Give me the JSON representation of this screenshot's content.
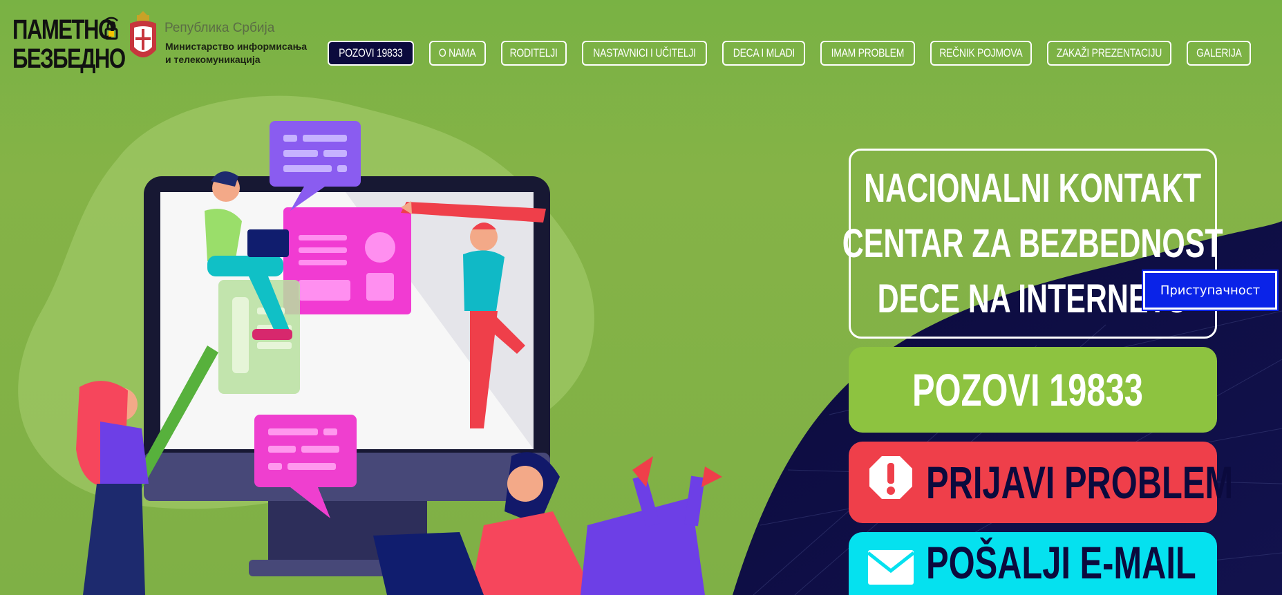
{
  "brand": {
    "logo_line1": "ПАМЕТНО",
    "logo_line2": "БЕЗБЕДНО",
    "gov_republic": "Република Србија",
    "gov_ministry_line1": "Министарство информисања",
    "gov_ministry_line2": "и телекомуникација"
  },
  "nav": {
    "items": [
      {
        "label": "POZOVI 19833",
        "active": true
      },
      {
        "label": "O NAMA"
      },
      {
        "label": "RODITELJI"
      },
      {
        "label": "NASTAVNICI I UČITELJI"
      },
      {
        "label": "DECA I MLADI"
      },
      {
        "label": "IMAM PROBLEM"
      },
      {
        "label": "REČNIK POJMOVA"
      },
      {
        "label": "ZAKAŽI PREZENTACIJU"
      },
      {
        "label": "GALERIJA"
      }
    ]
  },
  "hero": {
    "title_line1": "NACIONALNI KONTAKT",
    "title_line2": "CENTAR ZA BEZBEDNOST",
    "title_line3": "DECE NA INTERNETU",
    "call_label": "POZOVI 19833",
    "report_label": "PRIJAVI PROBLEM",
    "email_label": "POŠALJI E-MAIL"
  },
  "accessibility": {
    "label": "Приступачност"
  },
  "colors": {
    "background_green": "#7db544",
    "nav_active": "#0b0a3d",
    "call_green": "#8dc340",
    "report_red": "#ef3f4a",
    "email_cyan": "#05e1ef",
    "accessibility_blue": "#0a23e8"
  },
  "icons": {
    "report": "exclamation-octagon-icon",
    "email": "envelope-icon",
    "logo_lock": "lock-wifi-icon"
  }
}
